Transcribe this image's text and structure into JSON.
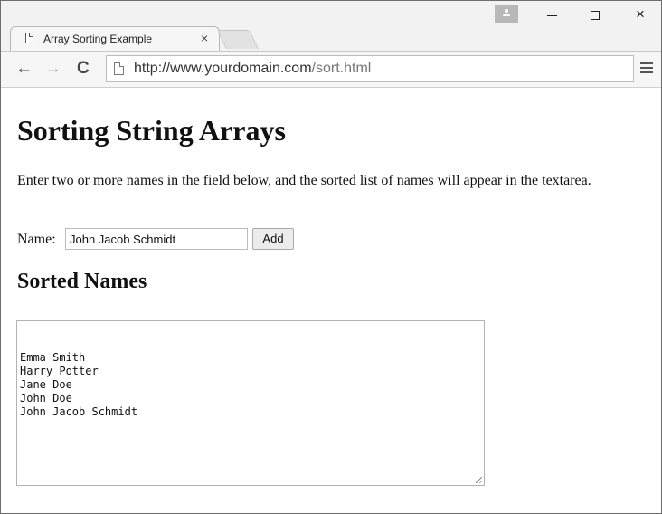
{
  "browser": {
    "tab": {
      "title": "Array Sorting Example",
      "close": "×"
    },
    "window_controls": {
      "close": "×"
    },
    "toolbar": {
      "back": "←",
      "forward": "→",
      "reload": "C",
      "url_prefix": "http://www.yourdomain.com",
      "url_path": "/sort.html"
    }
  },
  "page": {
    "heading": "Sorting String Arrays",
    "intro": "Enter two or more names in the field below, and the sorted list of names will appear in the textarea.",
    "name_label": "Name:",
    "name_value": "John Jacob Schmidt",
    "add_label": "Add",
    "sorted_heading": "Sorted Names",
    "sorted_names": [
      "Emma Smith",
      "Harry Potter",
      "Jane Doe",
      "John Doe",
      "John Jacob Schmidt"
    ]
  }
}
